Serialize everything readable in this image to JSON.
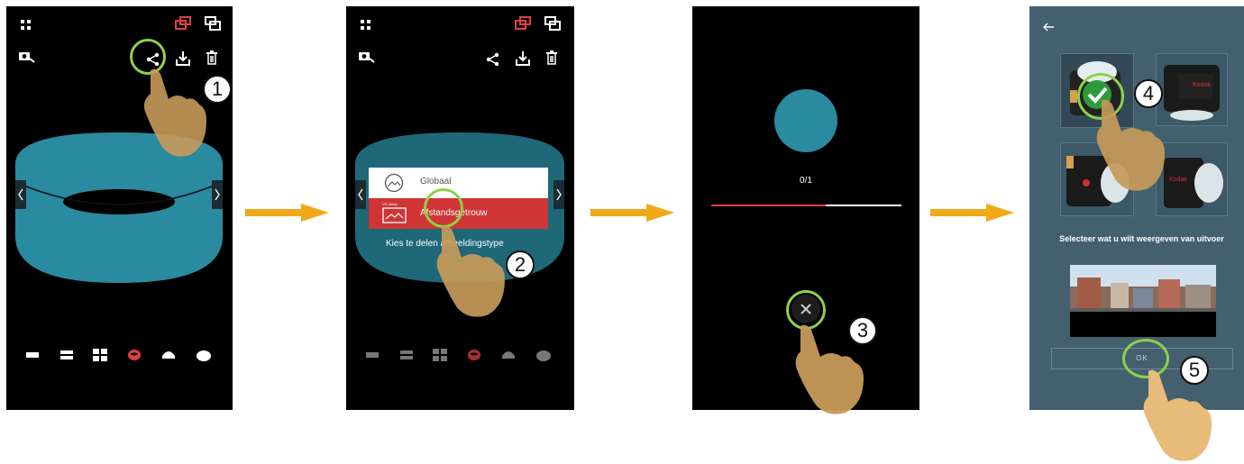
{
  "steps": [
    "1",
    "2",
    "3",
    "4",
    "5"
  ],
  "screen2": {
    "menu_item_global": "Globaal",
    "menu_item_distance": "Afstandsgetrouw",
    "menu_item_distance_small": "VR ability",
    "prompt": "Kies te delen afbeeldingstype"
  },
  "screen3": {
    "progress_text": "0/1",
    "progress_fraction": 0.6
  },
  "screen4": {
    "back_icon": "arrow-left-icon",
    "select_text": "Selecteer wat u wilt weergeven van uitvoer",
    "ok_label": "OK",
    "camera_options": [
      "camera-front-selected",
      "camera-side-kodak",
      "camera-front-lens",
      "camera-side-kodak-lens"
    ]
  },
  "colors": {
    "teal": "#2a8aa0",
    "red_accent": "#e04040",
    "highlight_ring": "#8ed14a",
    "arrow_orange": "#f1a91a",
    "dialog_bg": "#44606f"
  },
  "icons": [
    "grid-icon",
    "camera-switch-icon",
    "share-icon",
    "download-icon",
    "trash-icon",
    "dual-screen-icon",
    "swap-screen-icon",
    "close-icon"
  ]
}
